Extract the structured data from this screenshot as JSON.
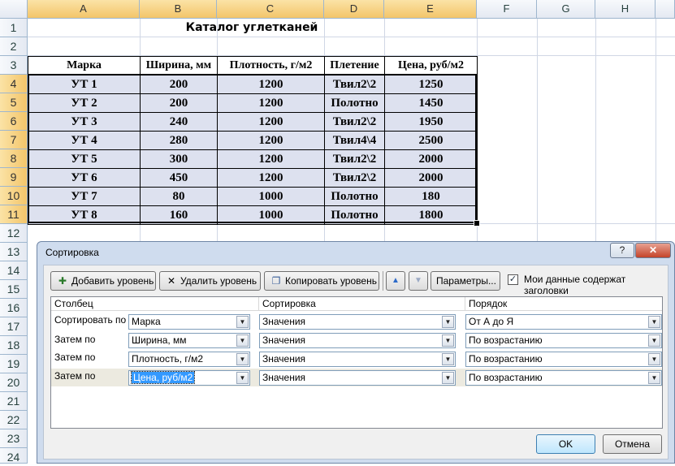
{
  "sheet": {
    "columns": [
      "A",
      "B",
      "C",
      "D",
      "E",
      "F",
      "G",
      "H"
    ],
    "rows": [
      "1",
      "2",
      "3",
      "4",
      "5",
      "6",
      "7",
      "8",
      "9",
      "10",
      "11",
      "12",
      "13",
      "14",
      "15",
      "16",
      "17",
      "18",
      "19",
      "20",
      "21",
      "22",
      "23",
      "24"
    ],
    "title": "Каталог углетканей",
    "headers": [
      "Марка",
      "Ширина, мм",
      "Плотность, г/м2",
      "Плетение",
      "Цена, руб/м2"
    ],
    "data": [
      [
        "УТ 1",
        "200",
        "1200",
        "Твил2\\2",
        "1250"
      ],
      [
        "УТ 2",
        "200",
        "1200",
        "Полотно",
        "1450"
      ],
      [
        "УТ 3",
        "240",
        "1200",
        "Твил2\\2",
        "1950"
      ],
      [
        "УТ 4",
        "280",
        "1200",
        "Твил4\\4",
        "2500"
      ],
      [
        "УТ 5",
        "300",
        "1200",
        "Твил2\\2",
        "2000"
      ],
      [
        "УТ 6",
        "450",
        "1200",
        "Твил2\\2",
        "2000"
      ],
      [
        "УТ 7",
        "80",
        "1000",
        "Полотно",
        "180"
      ],
      [
        "УТ 8",
        "160",
        "1000",
        "Полотно",
        "1800"
      ]
    ]
  },
  "dialog": {
    "title": "Сортировка",
    "help": "?",
    "close": "✕",
    "toolbar": {
      "add_level": "Добавить уровень",
      "delete_level": "Удалить уровень",
      "copy_level": "Копировать уровень",
      "up": "▲",
      "down": "▼",
      "options": "Параметры...",
      "has_headers": "Мои данные содержат заголовки",
      "has_headers_checked": "✓"
    },
    "columns_header": {
      "column": "Столбец",
      "sort_on": "Сортировка",
      "order": "Порядок"
    },
    "levels": [
      {
        "label": "Сортировать по",
        "column": "Марка",
        "sort_on": "Значения",
        "order": "От А до Я"
      },
      {
        "label": "Затем по",
        "column": "Ширина, мм",
        "sort_on": "Значения",
        "order": "По возрастанию"
      },
      {
        "label": "Затем по",
        "column": "Плотность, г/м2",
        "sort_on": "Значения",
        "order": "По возрастанию"
      },
      {
        "label": "Затем по",
        "column": "Цена, руб/м2",
        "sort_on": "Значения",
        "order": "По возрастанию"
      }
    ],
    "ok": "OK",
    "cancel": "Отмена"
  }
}
